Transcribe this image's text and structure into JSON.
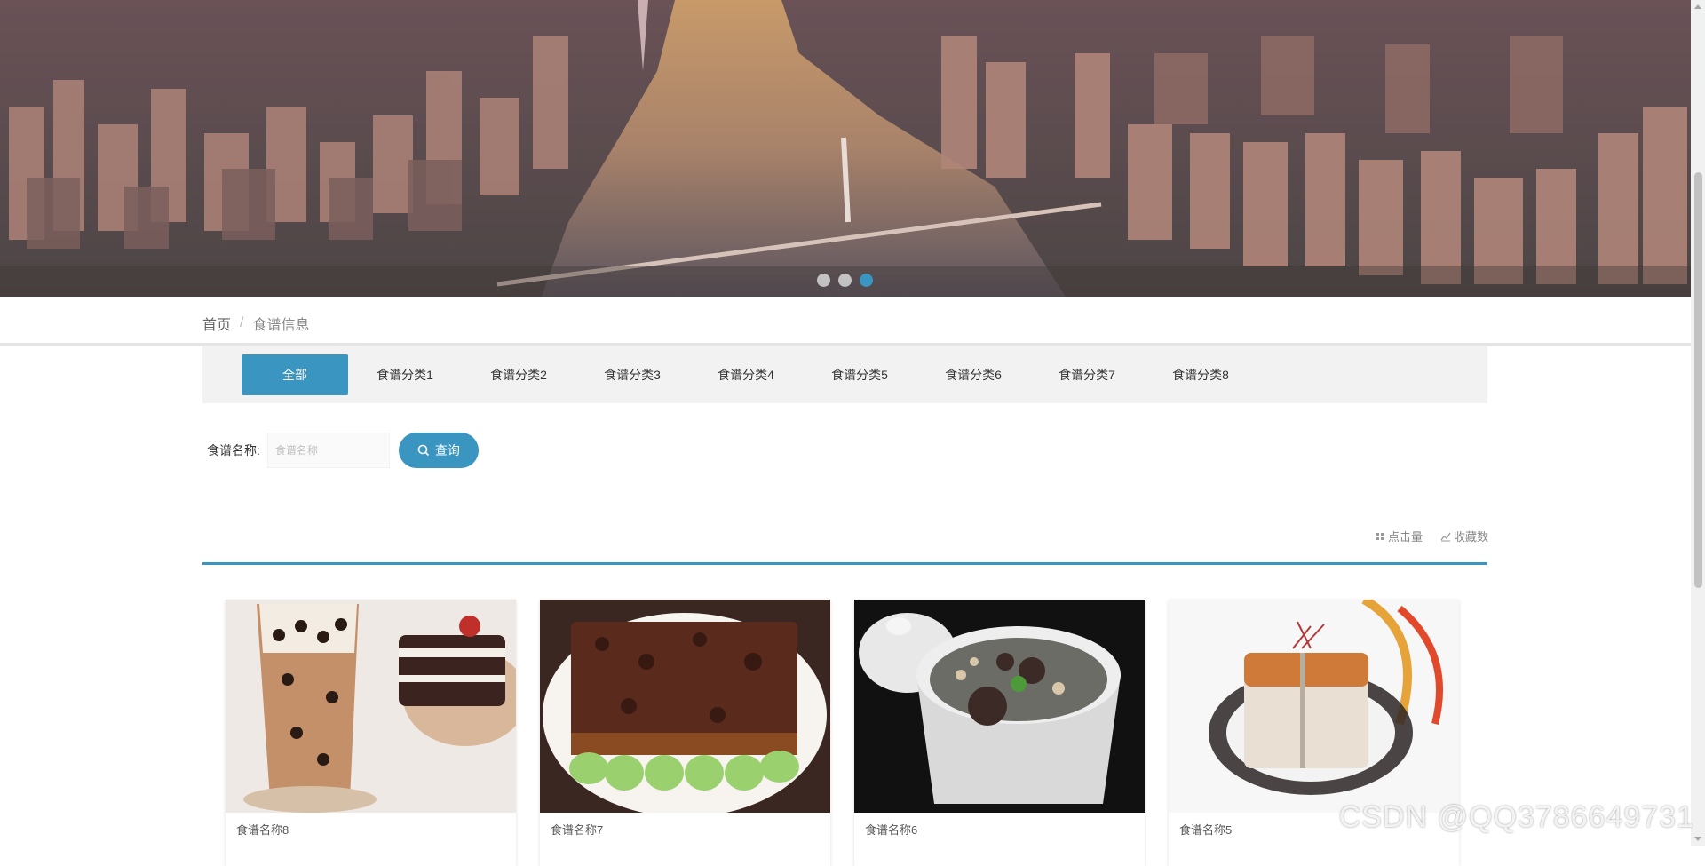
{
  "banner": {
    "slides": 3,
    "active_slide": 3,
    "dots": [
      "slide-1",
      "slide-2",
      "slide-3"
    ]
  },
  "breadcrumb": {
    "home": "首页",
    "separator": "/",
    "current": "食谱信息"
  },
  "categories": [
    {
      "label": "全部"
    },
    {
      "label": "食谱分类1"
    },
    {
      "label": "食谱分类2"
    },
    {
      "label": "食谱分类3"
    },
    {
      "label": "食谱分类4"
    },
    {
      "label": "食谱分类5"
    },
    {
      "label": "食谱分类6"
    },
    {
      "label": "食谱分类7"
    },
    {
      "label": "食谱分类8"
    }
  ],
  "search": {
    "label": "食谱名称:",
    "placeholder": "食谱名称",
    "value": "",
    "button_label": "查询"
  },
  "sort": {
    "clicks_label": "点击量",
    "favorites_label": "收藏数"
  },
  "cards": [
    {
      "title": "食谱名称8",
      "image": "bubble-tea-and-cake"
    },
    {
      "title": "食谱名称7",
      "image": "braised-tofu-with-greens"
    },
    {
      "title": "食谱名称6",
      "image": "stew-soup-pot"
    },
    {
      "title": "食谱名称5",
      "image": "roast-pork-plated"
    }
  ],
  "watermark": "CSDN @QQ3786649731",
  "colors": {
    "accent": "#3a95c0",
    "category_bar_bg": "#f2f2f2"
  }
}
